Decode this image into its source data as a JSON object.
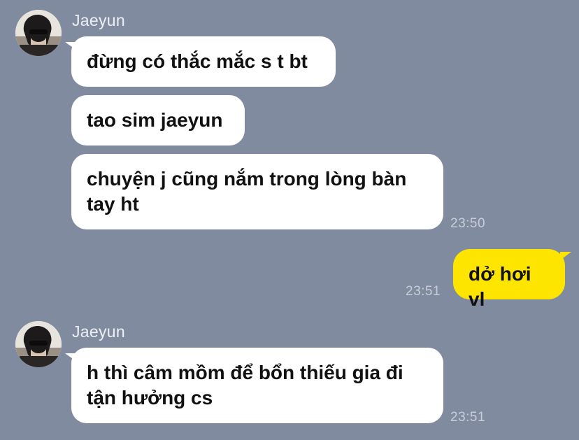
{
  "messages": [
    {
      "sender": "Jaeyun",
      "bubbles": [
        "đừng có thắc mắc s t bt",
        "tao sim jaeyun",
        "chuyện j cũng nắm trong lòng bàn tay ht"
      ],
      "time": "23:50"
    },
    {
      "sender": "me",
      "bubbles": [
        "dở hơi vl"
      ],
      "time": "23:51"
    },
    {
      "sender": "Jaeyun",
      "bubbles": [
        "h thì câm mồm để bổn thiếu gia đi tận hưởng cs"
      ],
      "time": "23:51"
    }
  ],
  "colors": {
    "background": "#818BA0",
    "incoming_bubble": "#FFFFFF",
    "outgoing_bubble": "#FEE500"
  }
}
